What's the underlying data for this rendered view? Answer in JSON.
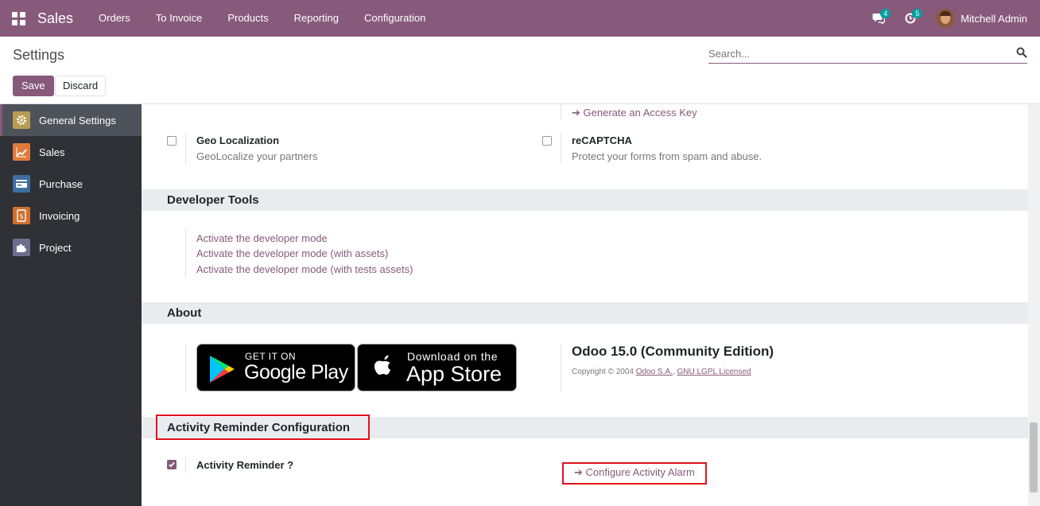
{
  "navbar": {
    "brand": "Sales",
    "menu": [
      "Orders",
      "To Invoice",
      "Products",
      "Reporting",
      "Configuration"
    ],
    "messages_count": "4",
    "activities_count": "5",
    "user_name": "Mitchell Admin"
  },
  "control_panel": {
    "breadcrumb": "Settings",
    "search_placeholder": "Search...",
    "save_label": "Save",
    "discard_label": "Discard"
  },
  "sidebar": {
    "items": [
      {
        "label": "General Settings",
        "color": "#b79d54"
      },
      {
        "label": "Sales",
        "color": "#e07a3c"
      },
      {
        "label": "Purchase",
        "color": "#3d6f9e"
      },
      {
        "label": "Invoicing",
        "color": "#d0702e"
      },
      {
        "label": "Project",
        "color": "#6d6f8c"
      }
    ]
  },
  "content": {
    "access_key_link": "Generate an Access Key",
    "geo": {
      "title": "Geo Localization",
      "desc": "GeoLocalize your partners",
      "checked": false
    },
    "recaptcha": {
      "title": "reCAPTCHA",
      "desc": "Protect your forms from spam and abuse.",
      "checked": false
    },
    "developer_tools": {
      "title": "Developer Tools",
      "links": [
        "Activate the developer mode",
        "Activate the developer mode (with assets)",
        "Activate the developer mode (with tests assets)"
      ]
    },
    "about": {
      "title": "About",
      "google_play_top": "GET IT ON",
      "google_play_bottom": "Google Play",
      "app_store_top": "Download on the",
      "app_store_bottom": "App Store",
      "version": "Odoo 15.0 (Community Edition)",
      "copyright_prefix": "Copyright © 2004",
      "company_link": "Odoo S.A.",
      "license_link": "GNU LGPL Licensed"
    },
    "activity": {
      "title": "Activity Reminder Configuration",
      "reminder_label": "Activity Reminder ?",
      "reminder_checked": true,
      "configure_link": "Configure Activity Alarm"
    }
  },
  "colors": {
    "brand": "#875a7b",
    "sidebar_bg": "#2f3136",
    "highlight": "#e0101d"
  }
}
